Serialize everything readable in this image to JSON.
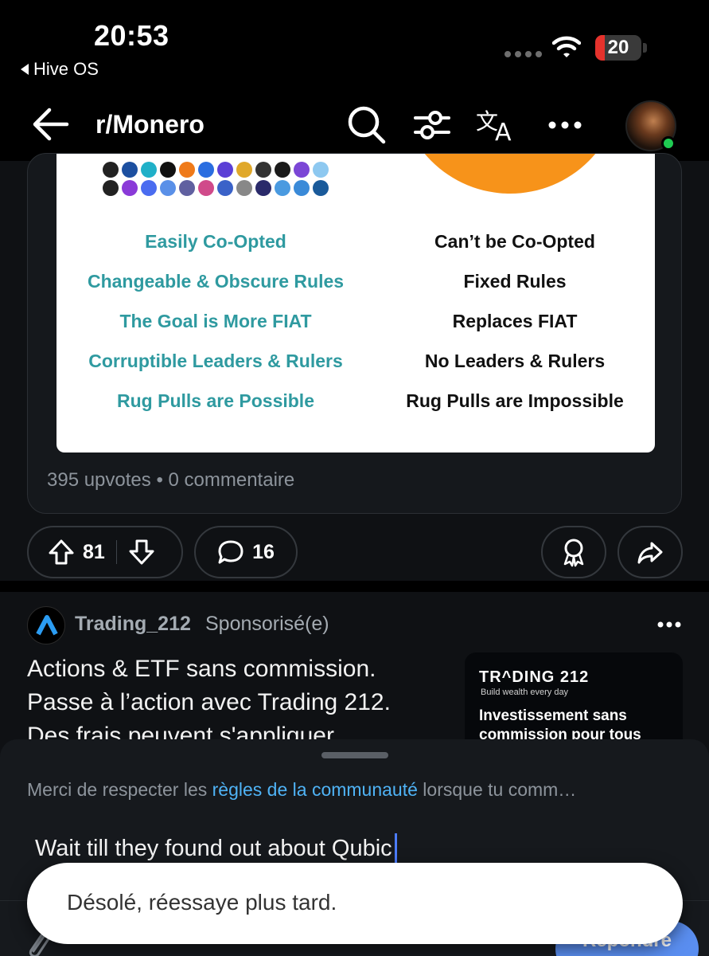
{
  "status_bar": {
    "time": "20:53",
    "back_app": "Hive OS",
    "battery_level": "20",
    "battery_color": "#e5322c"
  },
  "header": {
    "title": "r/Monero",
    "icons": [
      "back-arrow-icon",
      "search-icon",
      "filter-icon",
      "translate-icon",
      "more-icon",
      "avatar"
    ]
  },
  "post": {
    "image": {
      "left_column": [
        "Easily Co-Opted",
        "Changeable & Obscure Rules",
        "The Goal is More FIAT",
        "Corruptible Leaders & Rulers",
        "Rug Pulls are Possible"
      ],
      "right_column": [
        "Can’t be Co-Opted",
        "Fixed Rules",
        "Replaces FIAT",
        "No Leaders & Rulers",
        "Rug Pulls are Impossible"
      ]
    },
    "stats": "395 upvotes • 0 commentaire",
    "votes": "81",
    "comments": "16"
  },
  "ad": {
    "name": "Trading_212",
    "sponsored": "Sponsorisé(e)",
    "text_lines": [
      "Actions & ETF sans commission.",
      "Passe à l’action avec Trading 212.",
      "Des frais peuvent s'appliquer."
    ],
    "thumb": {
      "brand": "TR^DING 212",
      "tagline": "Build wealth every day",
      "headline": "Investissement sans commission pour tous"
    }
  },
  "comment_sheet": {
    "rules_prefix": "Merci de respecter les ",
    "rules_link": "règles de la communauté",
    "rules_suffix": " lorsque tu comm…",
    "input_value": "Wait till they found out about Qubic",
    "reply_label": "Répondre"
  },
  "toast": {
    "message": "Désolé, réessaye plus tard."
  },
  "colors": {
    "accent_link": "#4fb3f6",
    "reply_button": "#5a8ef0",
    "online": "#1fcb52",
    "bitcoin_orange": "#f7931a",
    "teal_text": "#2f9aa0"
  }
}
